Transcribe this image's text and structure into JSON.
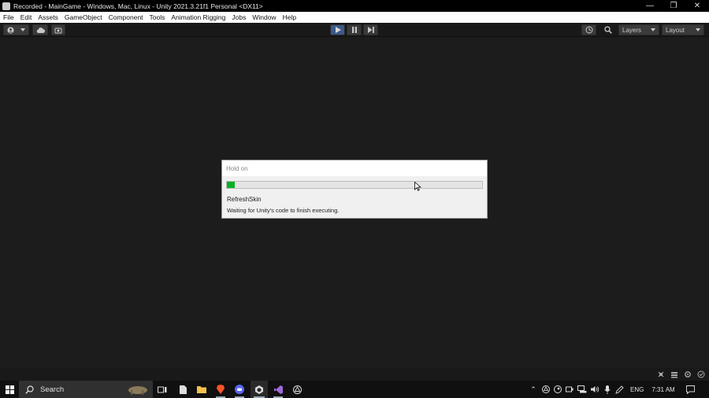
{
  "window": {
    "title": "Recorded - MainGame - Windows, Mac, Linux - Unity 2021.3.21f1 Personal <DX11>",
    "controls": {
      "minimize": "—",
      "restore": "❐",
      "close": "✕"
    }
  },
  "menu": [
    "File",
    "Edit",
    "Assets",
    "GameObject",
    "Component",
    "Tools",
    "Animation Rigging",
    "Jobs",
    "Window",
    "Help"
  ],
  "toolbar": {
    "account_icon": "account-icon",
    "cloud_icon": "cloud-icon",
    "collab_icon": "collab-icon",
    "play_icon": "▶",
    "pause_icon": "❚❚",
    "step_icon": "▶❙",
    "history_icon": "history-icon",
    "search_icon": "search-icon",
    "layers_label": "Layers",
    "layout_label": "Layout"
  },
  "dialog": {
    "title": "Hold on",
    "progress": 0.03,
    "line1": "RefreshSkin",
    "line2": "Waiting for Unity's code to finish executing."
  },
  "taskbar": {
    "search_placeholder": "Search",
    "lang": "ENG",
    "time": "7:31 AM"
  },
  "colors": {
    "progress_fill": "#06b025",
    "titlebar_bg": "#000000",
    "editor_bg": "#1c1c1c",
    "play_active": "#3b5a8a"
  }
}
